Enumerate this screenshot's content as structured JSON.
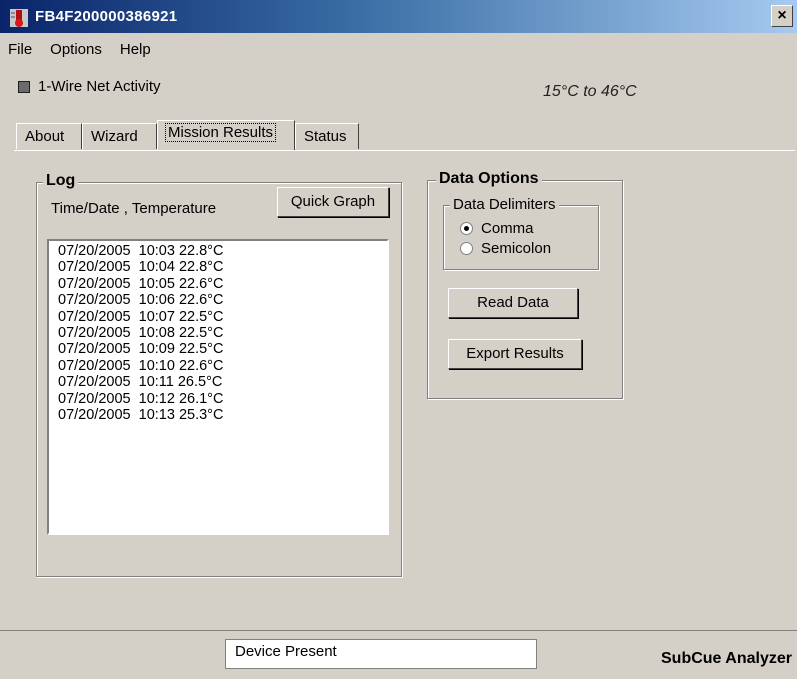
{
  "window": {
    "title": "FB4F200000386921",
    "close_glyph": "×"
  },
  "menu": [
    {
      "label": "File"
    },
    {
      "label": "Options"
    },
    {
      "label": "Help"
    }
  ],
  "activity": {
    "label": "1-Wire Net Activity",
    "range": "15°C to 46°C"
  },
  "tabs": [
    {
      "label": "About"
    },
    {
      "label": "Wizard"
    },
    {
      "label": "Mission Results"
    },
    {
      "label": "Status"
    }
  ],
  "log": {
    "title": "Log",
    "header": "Time/Date , Temperature",
    "quick_graph_label": "Quick Graph",
    "rows": [
      "07/20/2005  10:03 22.8°C",
      "07/20/2005  10:04 22.8°C",
      "07/20/2005  10:05 22.6°C",
      "07/20/2005  10:06 22.6°C",
      "07/20/2005  10:07 22.5°C",
      "07/20/2005  10:08 22.5°C",
      "07/20/2005  10:09 22.5°C",
      "07/20/2005  10:10 22.6°C",
      "07/20/2005  10:11 26.5°C",
      "07/20/2005  10:12 26.1°C",
      "07/20/2005  10:13 25.3°C"
    ]
  },
  "data_options": {
    "title": "Data Options",
    "delimiters_title": "Data Delimiters",
    "comma_label": "Comma",
    "semicolon_label": "Semicolon",
    "read_data_label": "Read Data",
    "export_results_label": "Export Results"
  },
  "status": {
    "device": "Device Present",
    "brand": "SubCue Analyzer"
  }
}
